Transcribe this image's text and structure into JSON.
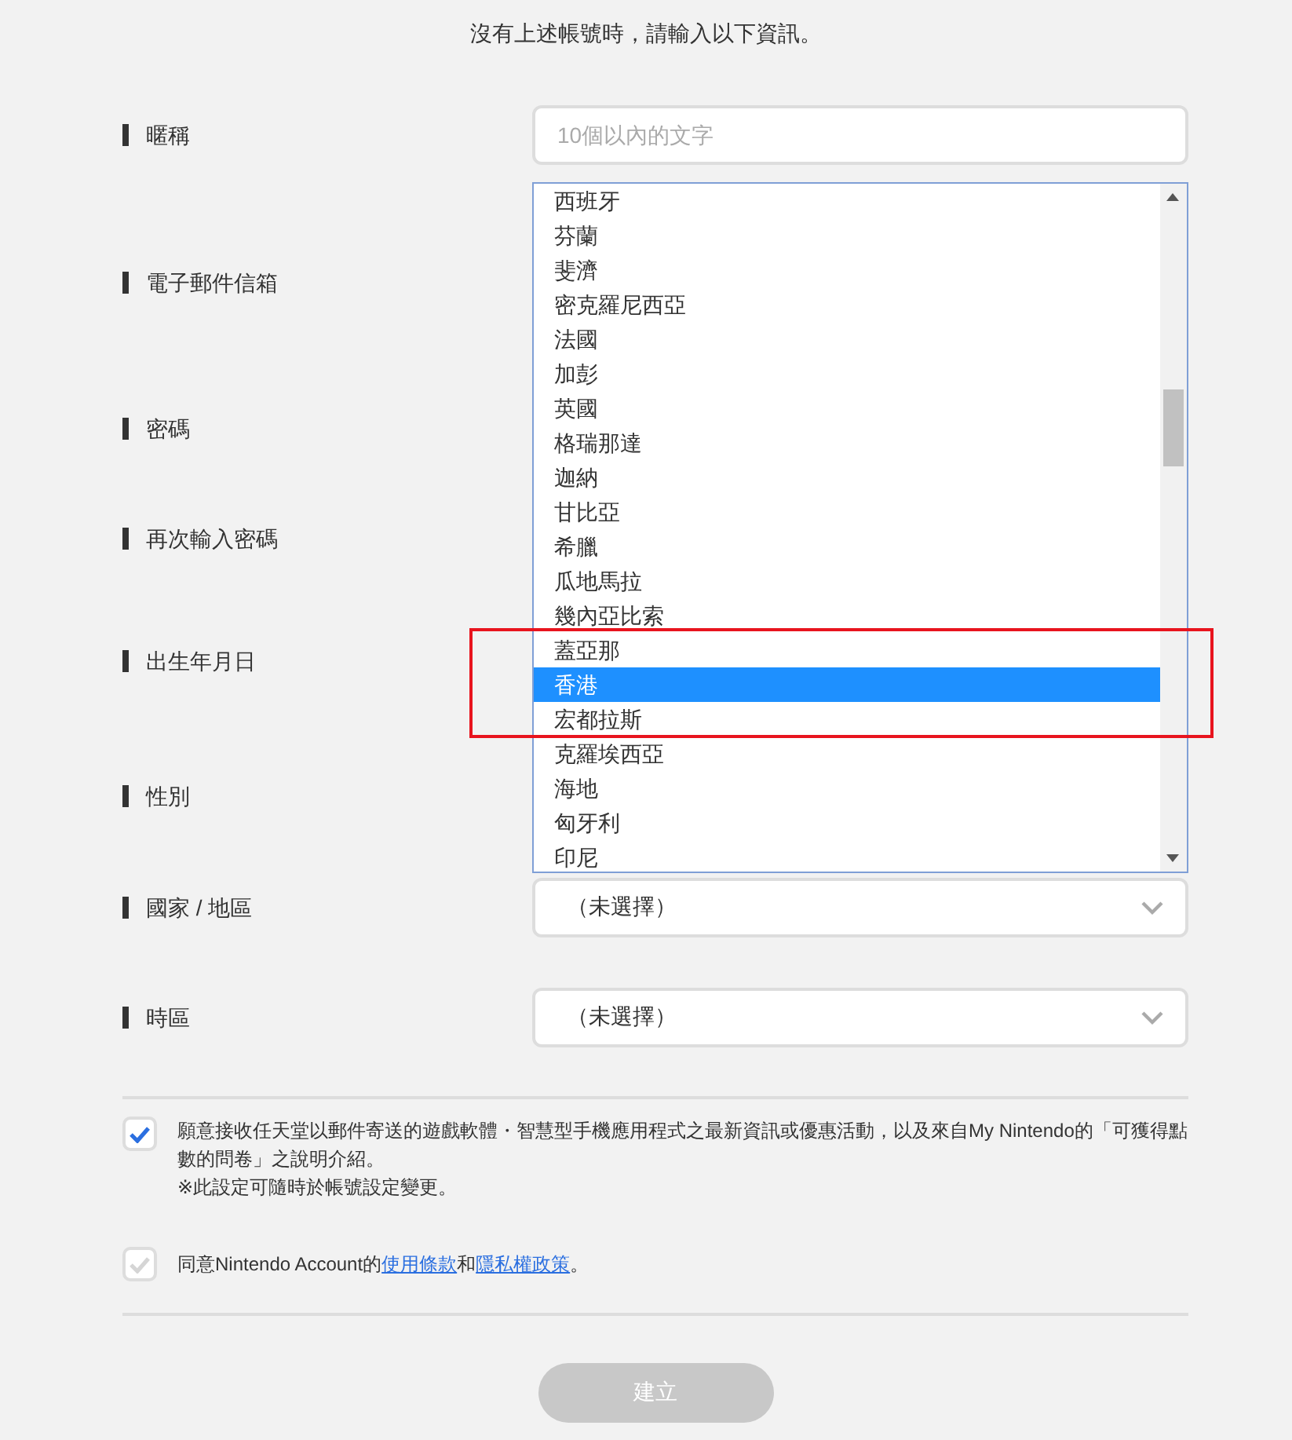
{
  "header": "沒有上述帳號時，請輸入以下資訊。",
  "fields": [
    {
      "label": "暱稱",
      "kind": "text",
      "placeholder": "10個以內的文字"
    },
    {
      "label": "電子郵件信箱",
      "kind": "covered"
    },
    {
      "label": "密碼",
      "kind": "covered"
    },
    {
      "label": "再次輸入密碼",
      "kind": "covered"
    },
    {
      "label": "出生年月日",
      "kind": "covered"
    },
    {
      "label": "性別",
      "kind": "covered"
    },
    {
      "label": "國家 / 地區",
      "kind": "select",
      "value": "（未選擇）"
    },
    {
      "label": "時區",
      "kind": "select",
      "value": "（未選擇）"
    }
  ],
  "dropdown": {
    "options": [
      {
        "label": "西班牙",
        "selected": false
      },
      {
        "label": "芬蘭",
        "selected": false
      },
      {
        "label": "斐濟",
        "selected": false
      },
      {
        "label": "密克羅尼西亞",
        "selected": false
      },
      {
        "label": "法國",
        "selected": false
      },
      {
        "label": "加彭",
        "selected": false
      },
      {
        "label": "英國",
        "selected": false
      },
      {
        "label": "格瑞那達",
        "selected": false
      },
      {
        "label": "迦納",
        "selected": false
      },
      {
        "label": "甘比亞",
        "selected": false
      },
      {
        "label": "希臘",
        "selected": false
      },
      {
        "label": "瓜地馬拉",
        "selected": false
      },
      {
        "label": "幾內亞比索",
        "selected": false
      },
      {
        "label": "蓋亞那",
        "selected": false
      },
      {
        "label": "香港",
        "selected": true
      },
      {
        "label": "宏都拉斯",
        "selected": false
      },
      {
        "label": "克羅埃西亞",
        "selected": false
      },
      {
        "label": "海地",
        "selected": false
      },
      {
        "label": "匈牙利",
        "selected": false
      },
      {
        "label": "印尼",
        "selected": false
      }
    ]
  },
  "checkboxes": [
    {
      "checked": true,
      "segments": [
        {
          "kind": "text",
          "text": "願意接收任天堂以郵件寄送的遊戲軟體・智慧型手機應用程式之最新資訊或優惠活動，以及來自My Nintendo的「可獲得點數的問卷」之說明介紹。"
        }
      ],
      "note": "※此設定可隨時於帳號設定變更。"
    },
    {
      "checked": false,
      "segments": [
        {
          "kind": "text",
          "text": "同意Nintendo Account的"
        },
        {
          "kind": "link",
          "text": "使用條款"
        },
        {
          "kind": "text",
          "text": "和"
        },
        {
          "kind": "link",
          "text": "隱私權政策"
        },
        {
          "kind": "text",
          "text": "。"
        }
      ]
    }
  ],
  "submit": {
    "label": "建立",
    "disabled": true
  },
  "annotation": {
    "color": "#e8141e"
  }
}
